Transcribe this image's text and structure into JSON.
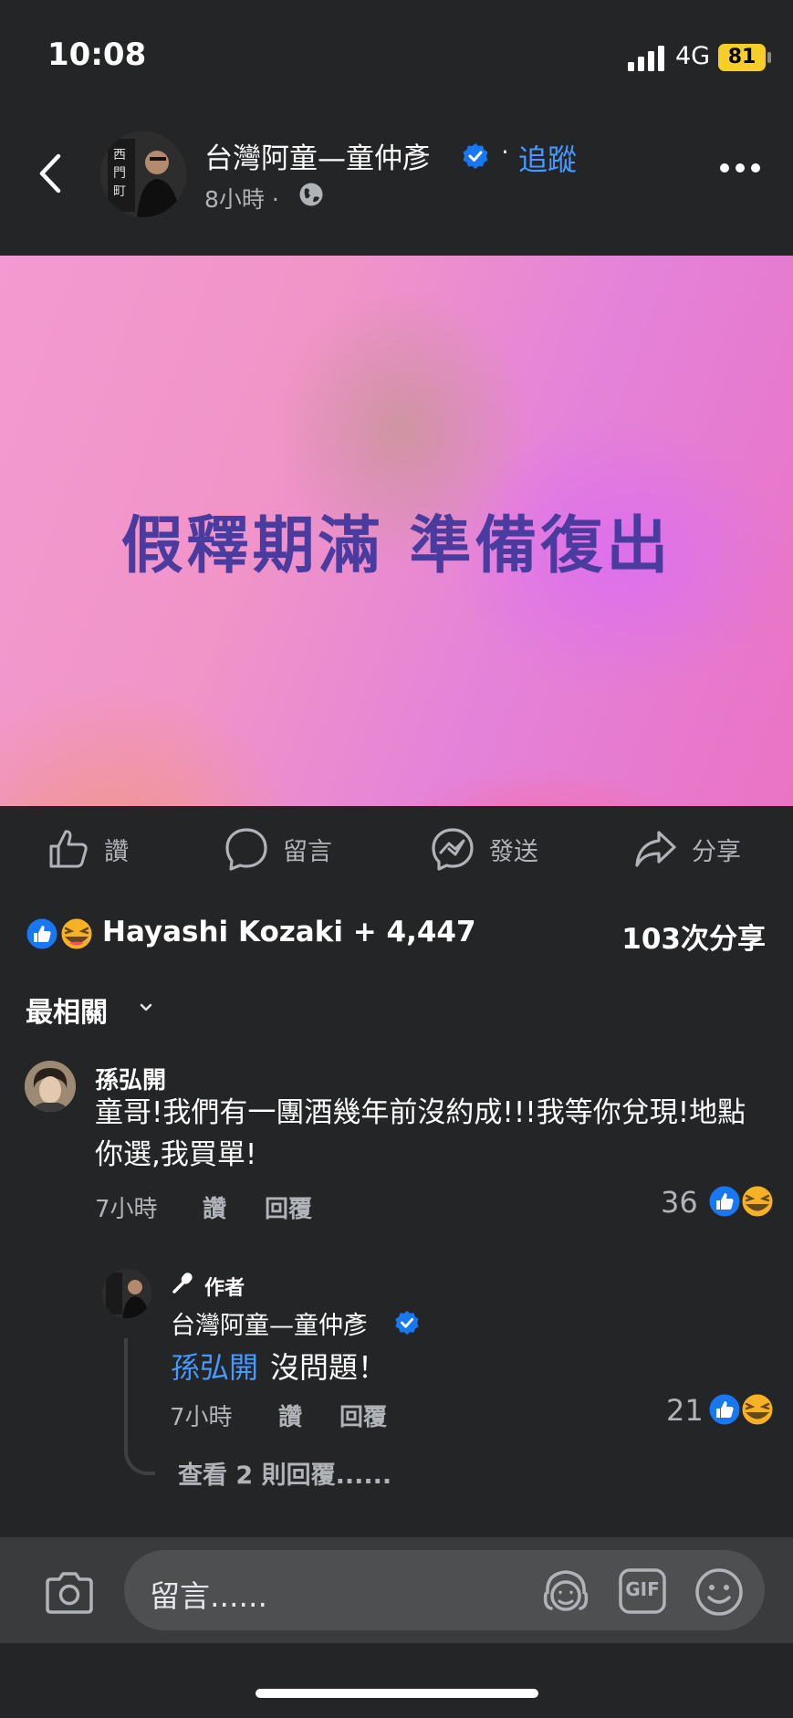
{
  "status_bar": {
    "time": "10:08",
    "network": "4G",
    "battery": "81"
  },
  "header": {
    "page_name": "台灣阿童—童仲彥",
    "follow_label": "追蹤",
    "separator": "·",
    "time_label": "8小時 ·",
    "icons": [
      "back-arrow-icon",
      "verified-badge-icon",
      "globe-icon",
      "more-options-icon"
    ]
  },
  "post": {
    "image_text": "假釋期滿 準備復出"
  },
  "actions": {
    "like": "讚",
    "comment": "留言",
    "send": "發送",
    "share": "分享"
  },
  "reactions": {
    "summary": "Hayashi Kozaki + 4,447",
    "shares": "103次分享"
  },
  "sort": {
    "label": "最相關"
  },
  "comment": {
    "author": "孫弘開",
    "text": "童哥!我們有一團酒幾年前沒約成!!!我等你兌現!地點你選,我買單!",
    "time": "7小時",
    "like_label": "讚",
    "reply_label": "回覆",
    "reaction_count": "36"
  },
  "reply": {
    "badge": "作者",
    "author": "台灣阿童—童仲彥",
    "mention": "孫弘開",
    "text": "沒問題！",
    "time": "7小時",
    "like_label": "讚",
    "reply_label": "回覆",
    "reaction_count": "21",
    "view_more": "查看 2 則回覆......"
  },
  "composer": {
    "placeholder": "留言......",
    "gif_label": "GIF"
  },
  "colors": {
    "background": "#242526",
    "accent": "#4599ff",
    "post_text": "#4a3c9e"
  }
}
